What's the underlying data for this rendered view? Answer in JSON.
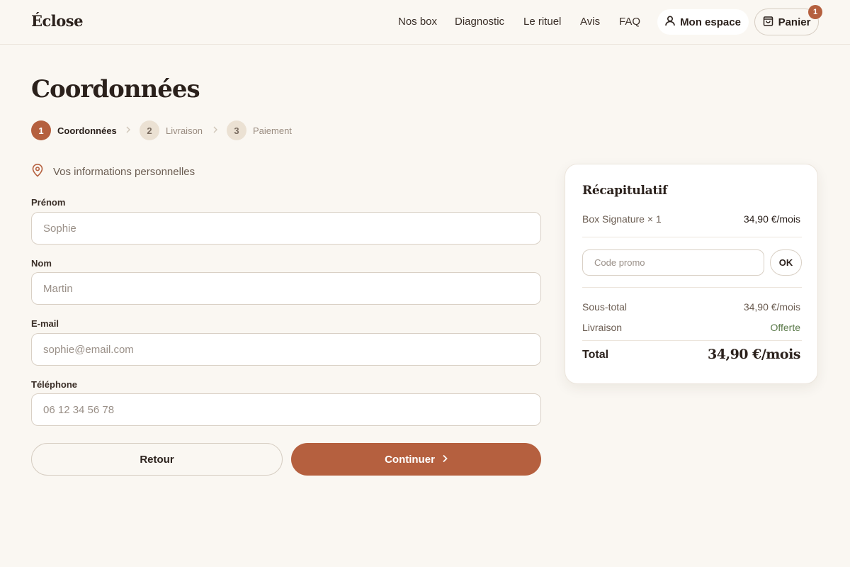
{
  "header": {
    "logo": "Éclose",
    "nav": [
      "Nos box",
      "Diagnostic",
      "Le rituel",
      "Avis",
      "FAQ"
    ],
    "account_label": "Mon espace",
    "cart_label": "Panier",
    "cart_count": "1"
  },
  "page": {
    "title": "Coordonnées"
  },
  "stepper": {
    "steps": [
      {
        "num": "1",
        "label": "Coordonnées",
        "state": "active"
      },
      {
        "num": "2",
        "label": "Livraison",
        "state": "inactive"
      },
      {
        "num": "3",
        "label": "Paiement",
        "state": "inactive"
      }
    ]
  },
  "form": {
    "section_title": "Vos informations personnelles",
    "fields": [
      {
        "label": "Prénom",
        "placeholder": "Sophie",
        "value": ""
      },
      {
        "label": "Nom",
        "placeholder": "Martin",
        "value": ""
      },
      {
        "label": "E-mail",
        "placeholder": "sophie@email.com",
        "value": ""
      },
      {
        "label": "Téléphone",
        "placeholder": "06 12 34 56 78",
        "value": ""
      }
    ],
    "back_label": "Retour",
    "continue_label": "Continuer"
  },
  "summary": {
    "title": "Récapitulatif",
    "item_name": "Box Signature × 1",
    "item_price": "34,90 €/mois",
    "promo_placeholder": "Code promo",
    "promo_button": "OK",
    "subtotal_label": "Sous-total",
    "subtotal_value": "34,90 €/mois",
    "shipping_label": "Livraison",
    "shipping_value": "Offerte",
    "total_label": "Total",
    "total_value": "34,90 €/mois"
  },
  "colors": {
    "accent": "#b5603f",
    "background": "#faf7f2",
    "success": "#5b7a4a",
    "text": "#2b211c"
  },
  "icons": {
    "account": "user-icon",
    "cart": "shopping-bag-icon",
    "section": "map-pin-icon",
    "continue": "chevron-right-icon"
  }
}
